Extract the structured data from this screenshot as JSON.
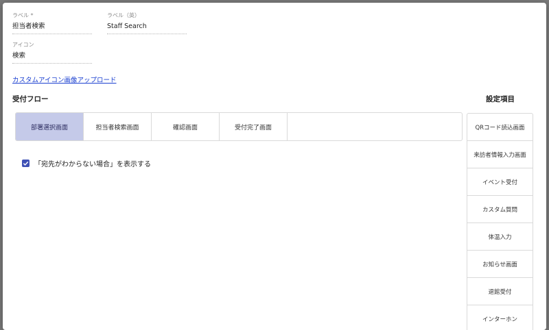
{
  "form": {
    "label": {
      "title": "ラベル *",
      "value": "担当者検索"
    },
    "label_en": {
      "title": "ラベル（英）",
      "value": "Staff Search"
    },
    "icon": {
      "title": "アイコン",
      "value": "検索"
    },
    "upload_link": "カスタムアイコン画像アップロード"
  },
  "flow": {
    "heading": "受付フロー",
    "tabs": [
      {
        "label": "部署選択画面",
        "active": true
      },
      {
        "label": "担当者検索画面",
        "active": false
      },
      {
        "label": "確認画面",
        "active": false
      },
      {
        "label": "受付完了画面",
        "active": false
      }
    ],
    "checkbox": {
      "label": "「宛先がわからない場合」を表示する",
      "checked": true
    }
  },
  "settings": {
    "heading": "設定項目",
    "items": [
      "QRコード読込画面",
      "来訪者情報入力画面",
      "イベント受付",
      "カスタム質問",
      "体温入力",
      "お知らせ画面",
      "退館受付",
      "インターホン"
    ]
  },
  "colors": {
    "active_tab": "#c5cae9",
    "checkbox": "#3f51b5",
    "link": "#1a3fd0"
  }
}
